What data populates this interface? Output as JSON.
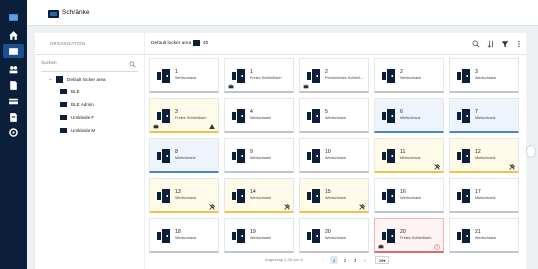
{
  "colors": {
    "rail": "#0b1f3a",
    "accent": "#1b4f8f",
    "blue_card": "#eef4fb",
    "yellow_card": "#fffbe8",
    "red_card": "#fff3f3"
  },
  "rail": {
    "items": [
      {
        "name": "rail-logo-icon",
        "icon": "locker"
      },
      {
        "name": "rail-home-icon",
        "icon": "home"
      },
      {
        "name": "rail-lockers-icon",
        "icon": "locker",
        "active": true
      },
      {
        "name": "rail-users-icon",
        "icon": "users"
      },
      {
        "name": "rail-doc-icon",
        "icon": "document"
      },
      {
        "name": "rail-card-icon",
        "icon": "card"
      },
      {
        "name": "rail-report-icon",
        "icon": "report"
      },
      {
        "name": "rail-settings-icon",
        "icon": "gear"
      }
    ]
  },
  "topbar": {
    "title": "Schränke"
  },
  "sidebar": {
    "header": "ORGANIZATION",
    "search_placeholder": "Suchen",
    "tree": {
      "root": "Default locker area",
      "children": [
        "BLE",
        "BLE Admin",
        "Umkleide F",
        "Umkleide M"
      ]
    }
  },
  "main": {
    "area_label": "Default locker area",
    "count": "40",
    "lockers": [
      {
        "num": "1",
        "type": "Wertschrank",
        "state": "normal"
      },
      {
        "num": "1",
        "type": "Freies Schließfach",
        "state": "normal",
        "badge": "bot-left"
      },
      {
        "num": "2",
        "type": "Persönliches Schließ…",
        "state": "normal",
        "badge": "bot-left"
      },
      {
        "num": "2",
        "type": "Wertschrank",
        "state": "normal"
      },
      {
        "num": "3",
        "type": "Wertschrank",
        "state": "normal"
      },
      {
        "num": "3",
        "type": "Freies Schließfach",
        "state": "yellow",
        "badge": "bot-left",
        "warn": true
      },
      {
        "num": "4",
        "type": "Wertschrank",
        "state": "normal"
      },
      {
        "num": "5",
        "type": "Wertschrank",
        "state": "normal"
      },
      {
        "num": "6",
        "type": "Mietschrank",
        "state": "blue"
      },
      {
        "num": "7",
        "type": "Mietschrank",
        "state": "blue"
      },
      {
        "num": "8",
        "type": "Mietschrank",
        "state": "blue"
      },
      {
        "num": "9",
        "type": "Wertschrank",
        "state": "normal"
      },
      {
        "num": "10",
        "type": "Wertschrank",
        "state": "normal"
      },
      {
        "num": "11",
        "type": "Mietschrank",
        "state": "yellow",
        "tool": true
      },
      {
        "num": "12",
        "type": "Mietschrank",
        "state": "yellow",
        "tool": true
      },
      {
        "num": "13",
        "type": "Wertschrank",
        "state": "yellow",
        "tool": true
      },
      {
        "num": "14",
        "type": "Wertschrank",
        "state": "yellow",
        "tool": true
      },
      {
        "num": "15",
        "type": "Wertschrank",
        "state": "yellow",
        "tool": true
      },
      {
        "num": "16",
        "type": "Wertschrank",
        "state": "normal"
      },
      {
        "num": "17",
        "type": "Mietschrank",
        "state": "normal"
      },
      {
        "num": "18",
        "type": "Wertschrank",
        "state": "normal"
      },
      {
        "num": "19",
        "type": "Wertschrank",
        "state": "normal"
      },
      {
        "num": "20",
        "type": "Wertschrank",
        "state": "normal"
      },
      {
        "num": "20",
        "type": "Freies Schließfach",
        "state": "red",
        "badge": "bot-left",
        "alert": true
      },
      {
        "num": "21",
        "type": "Wertschrank",
        "state": "normal"
      }
    ],
    "pager": {
      "text": "Angezeigt 1-25 von 0",
      "pages": [
        "1",
        "2",
        "3"
      ],
      "active": "1",
      "size": "25"
    }
  }
}
